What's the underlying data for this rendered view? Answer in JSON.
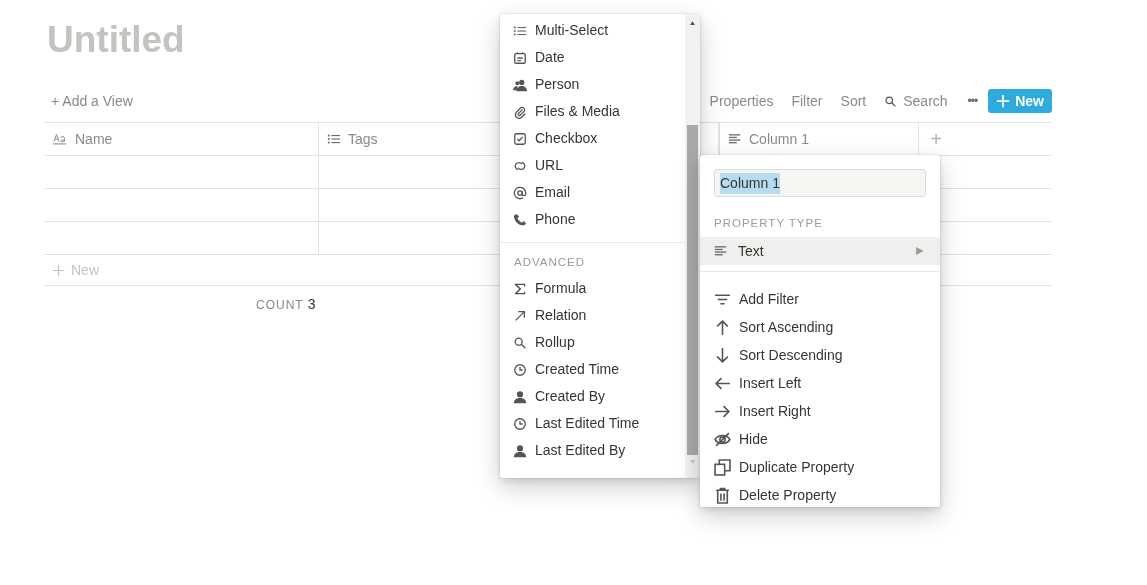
{
  "page": {
    "title": "Untitled"
  },
  "toolbar": {
    "add_view": "+ Add a View",
    "actions": [
      "Properties",
      "Filter",
      "Sort",
      "Search"
    ],
    "more": "•••",
    "new_button": "New"
  },
  "table": {
    "columns": [
      {
        "name": "Name"
      },
      {
        "name": "Tags"
      },
      {
        "name": "Column 1"
      }
    ],
    "add_column": "+",
    "new_row": "New",
    "count_label": "COUNT",
    "count_value": "3"
  },
  "type_menu": {
    "basic_items": [
      "Multi-Select",
      "Date",
      "Person",
      "Files & Media",
      "Checkbox",
      "URL",
      "Email",
      "Phone"
    ],
    "advanced_heading": "ADVANCED",
    "advanced_items": [
      "Formula",
      "Relation",
      "Rollup",
      "Created Time",
      "Created By",
      "Last Edited Time",
      "Last Edited By"
    ]
  },
  "property_menu": {
    "name_value": "Column 1",
    "heading": "PROPERTY TYPE",
    "type": {
      "label": "Text",
      "selected": true
    },
    "actions": [
      "Add Filter",
      "Sort Ascending",
      "Sort Descending",
      "Insert Left",
      "Insert Right",
      "Hide",
      "Duplicate Property",
      "Delete Property"
    ]
  }
}
